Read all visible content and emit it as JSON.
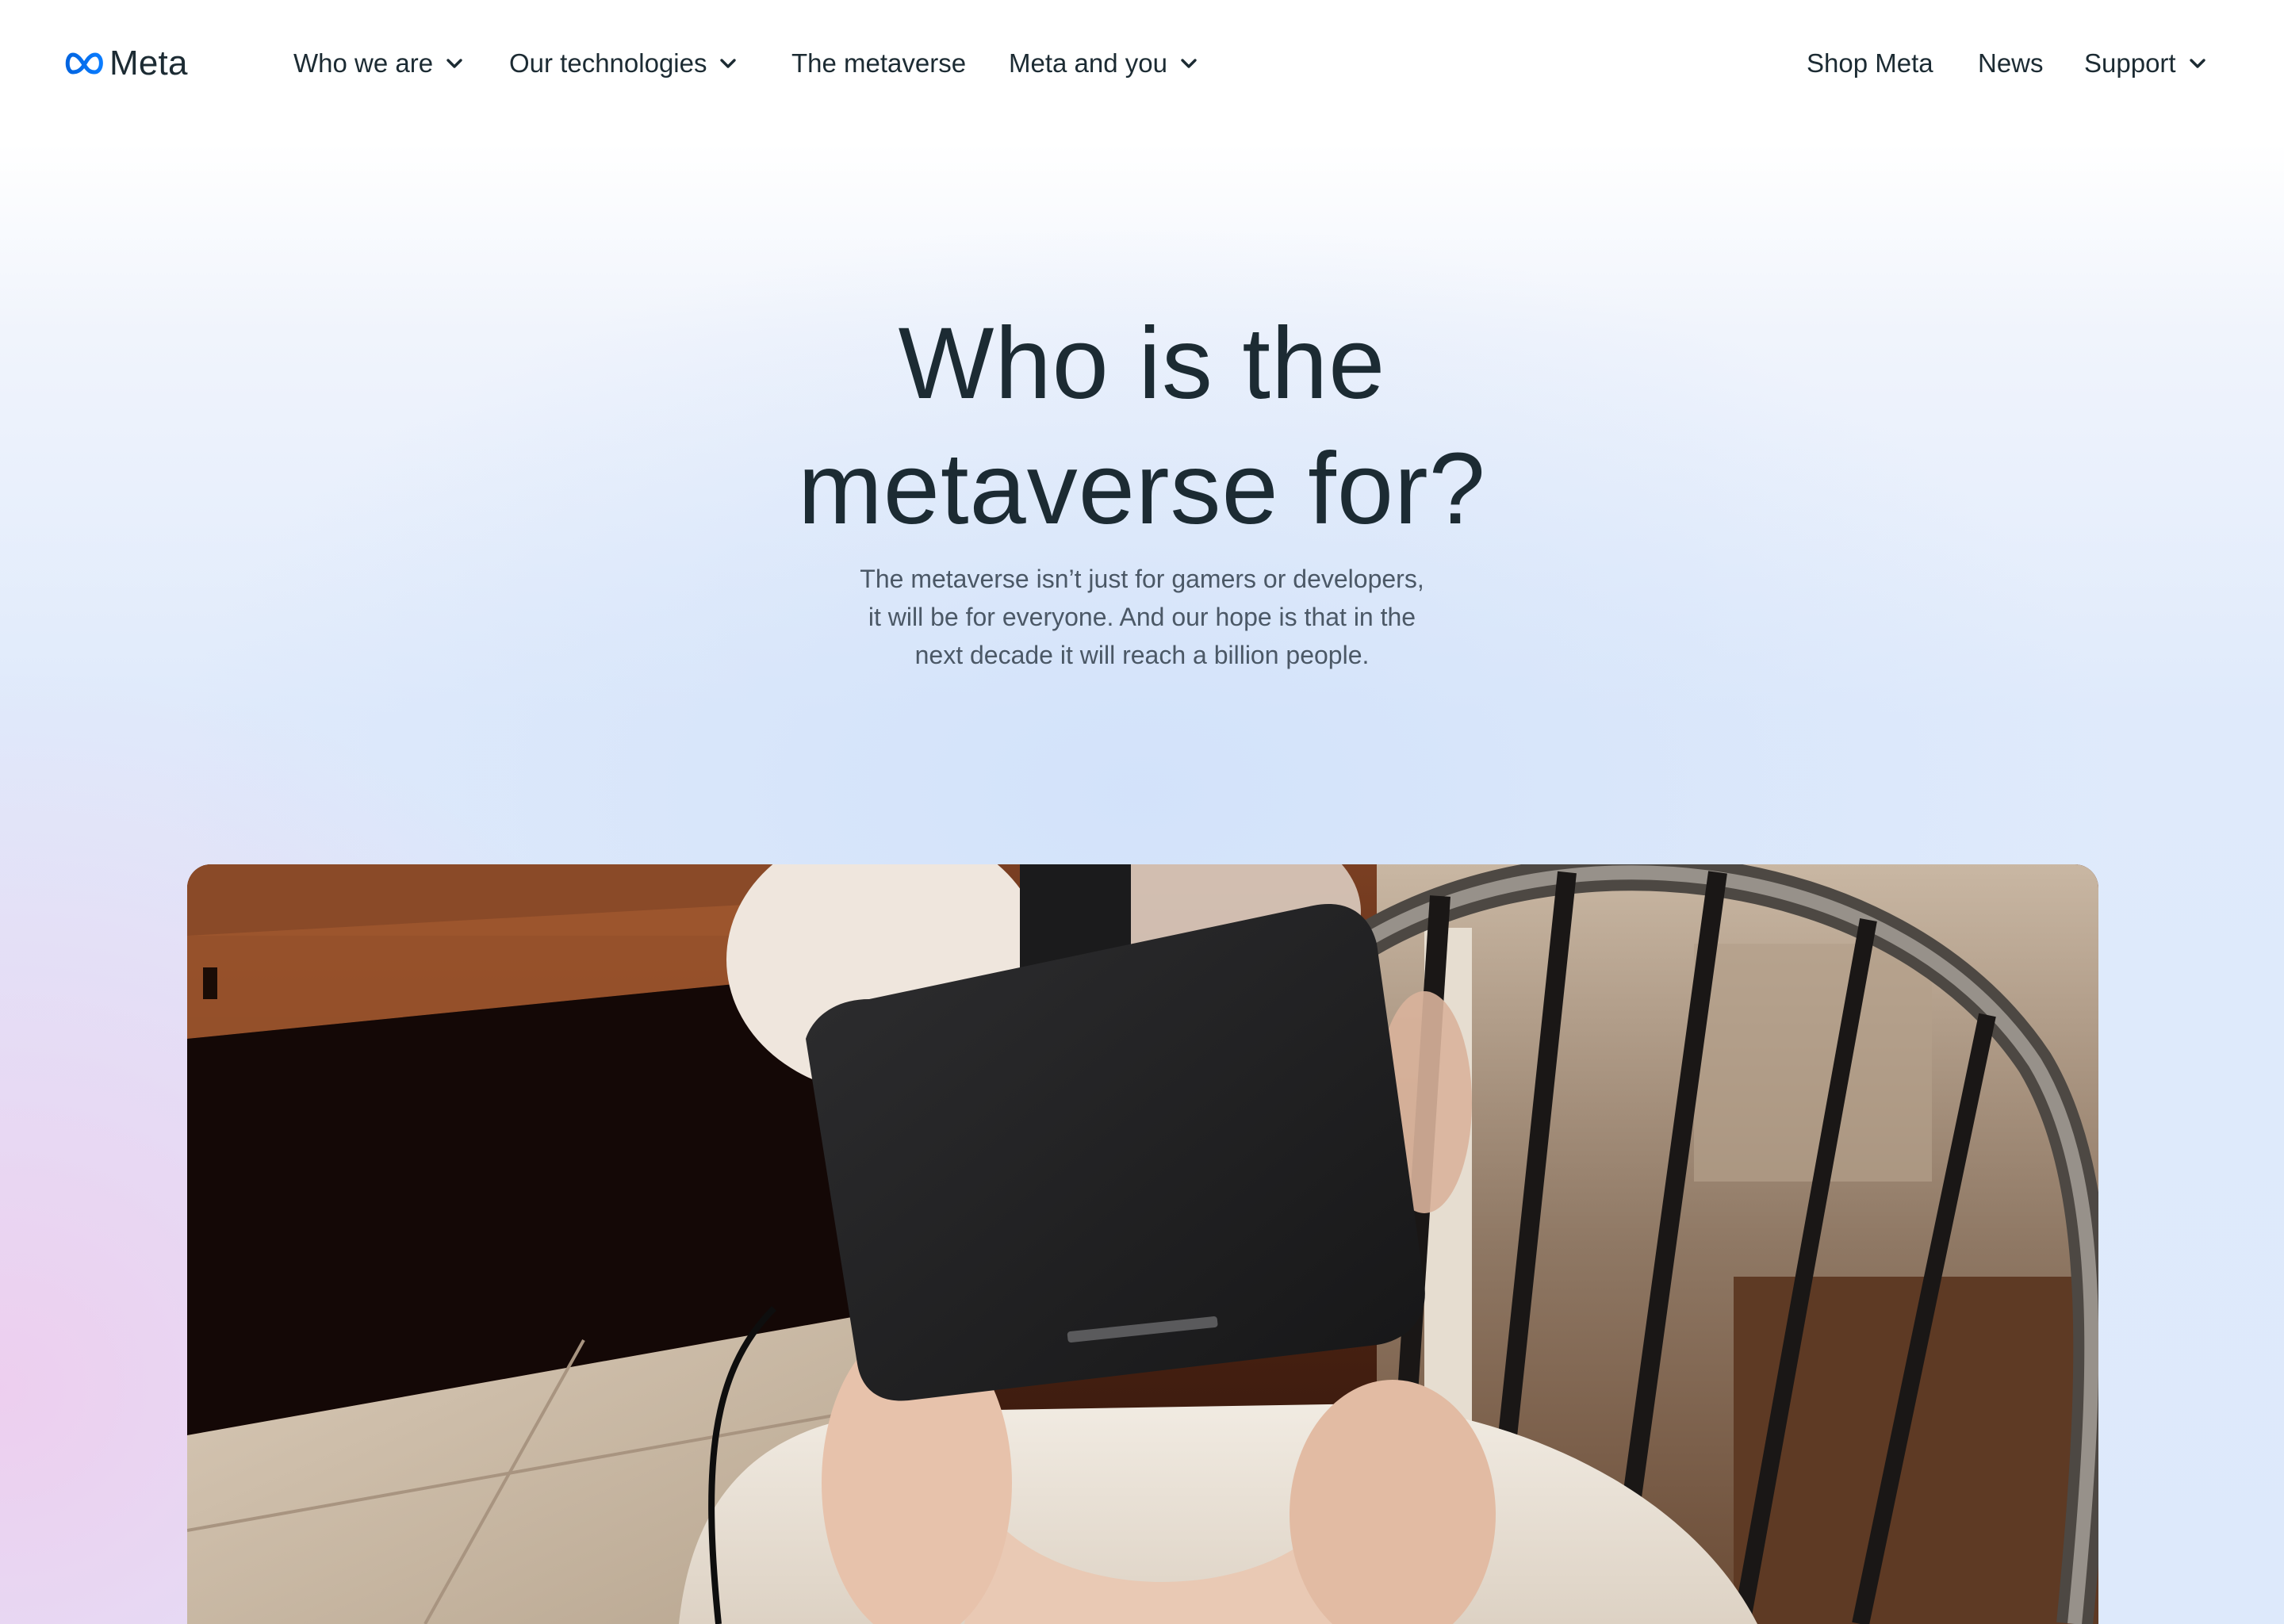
{
  "brand": {
    "name": "Meta",
    "logo_icon": "meta-infinity-logo",
    "logo_color": "#0a7cff"
  },
  "nav": {
    "items": [
      {
        "label": "Who we are",
        "has_dropdown": true
      },
      {
        "label": "Our technologies",
        "has_dropdown": true
      },
      {
        "label": "The metaverse",
        "has_dropdown": false
      },
      {
        "label": "Meta and you",
        "has_dropdown": true
      }
    ],
    "right_items": [
      {
        "label": "Shop Meta",
        "has_dropdown": false
      },
      {
        "label": "News",
        "has_dropdown": false
      },
      {
        "label": "Support",
        "has_dropdown": true
      }
    ],
    "dropdown_icon": "chevron-down-icon"
  },
  "hero": {
    "title_line1": "Who is the",
    "title_line2": "metaverse for?",
    "subtitle_line1": "The metaverse isn’t just for gamers or developers,",
    "subtitle_line2": "it will be for everyone. And our hope is that in the",
    "subtitle_line3": "next decade it will reach a billion people."
  },
  "media": {
    "kind": "photo",
    "depicts": "older person holding a black VR headset to face, seated in a wooden chair"
  },
  "colors": {
    "text_primary": "#1c2b33",
    "text_secondary": "#4b5866",
    "background_gradient_blue": "#dde9fb",
    "background_gradient_pink": "#eecdee"
  }
}
